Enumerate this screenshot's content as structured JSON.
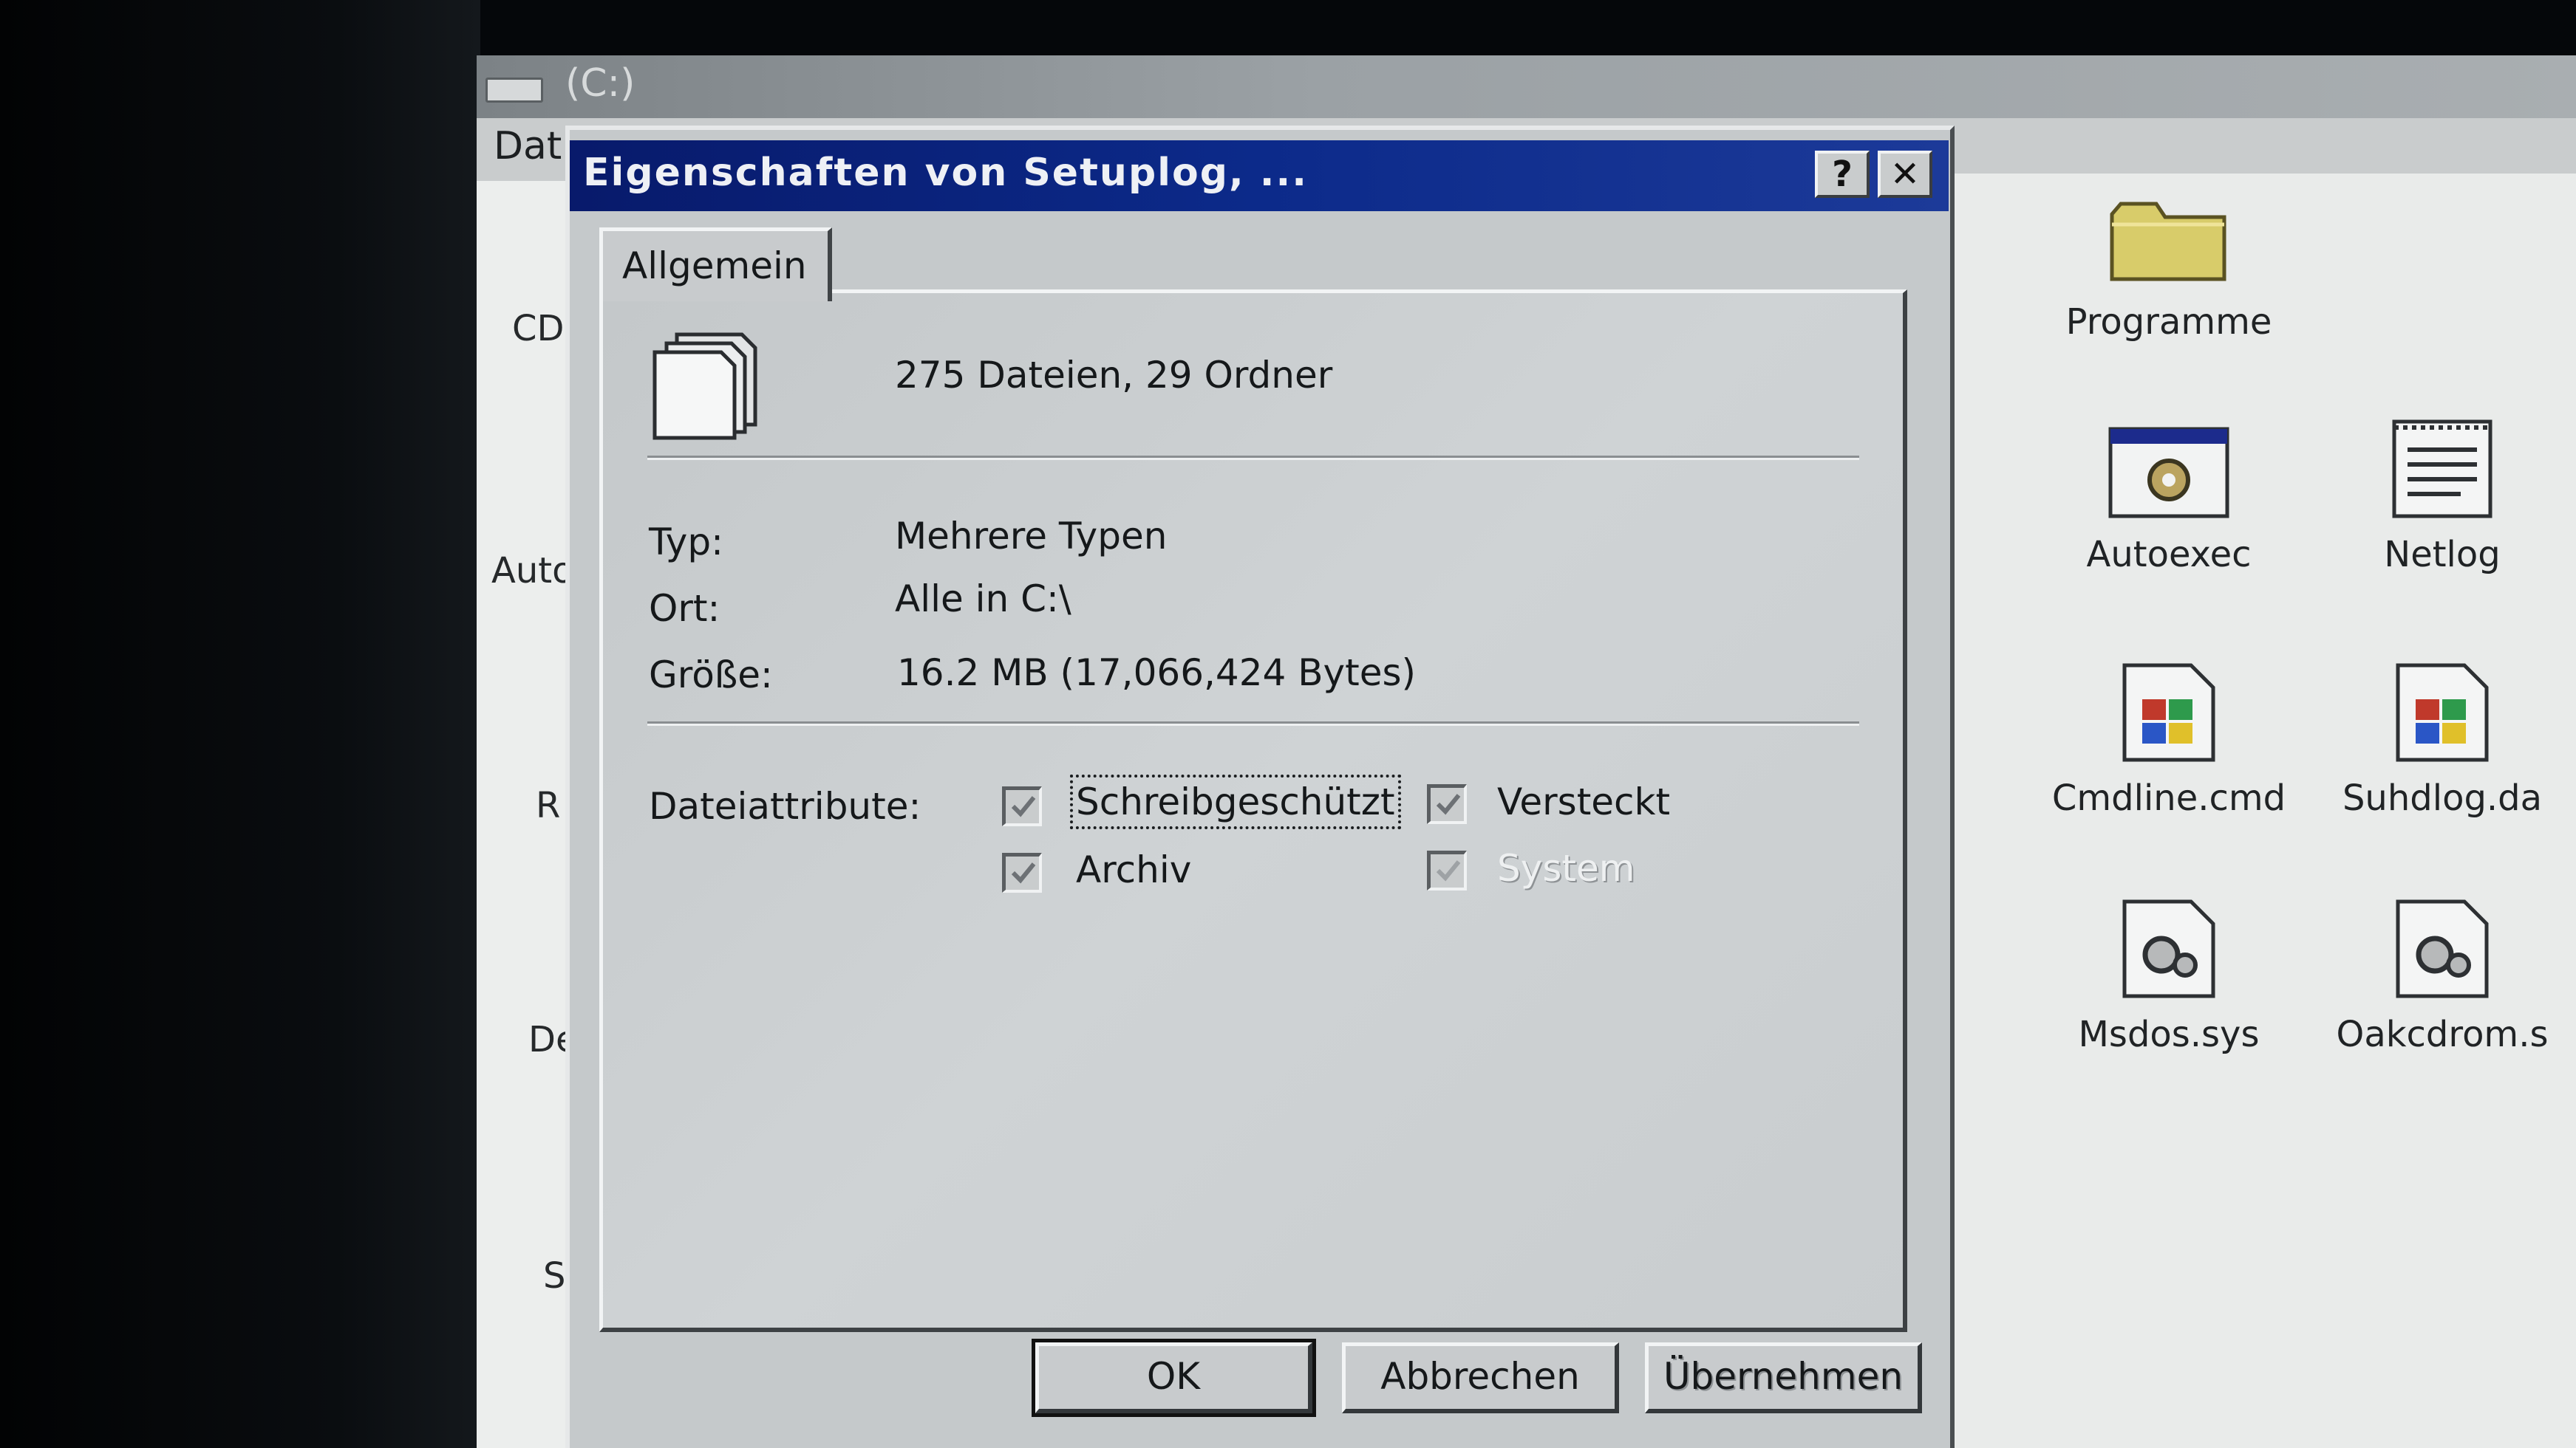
{
  "explorer": {
    "title": "(C:)",
    "menu_fragment": "Dat",
    "left_labels": [
      "CD",
      "Auto",
      "R",
      "De",
      "S"
    ],
    "files": [
      {
        "name": "Programme",
        "icon": "folder-icon"
      },
      {
        "name": "Autoexec",
        "icon": "batch-file-icon"
      },
      {
        "name": "Netlog",
        "icon": "text-file-icon"
      },
      {
        "name": "Cmdline.cmd",
        "icon": "windows-file-icon"
      },
      {
        "name": "Suhdlog.da",
        "icon": "windows-file-icon"
      },
      {
        "name": "Msdos.sys",
        "icon": "system-file-icon"
      },
      {
        "name": "Oakcdrom.s",
        "icon": "system-file-icon"
      }
    ]
  },
  "dialog": {
    "title": "Eigenschaften von Setuplog, ...",
    "help_label": "?",
    "close_label": "✕",
    "tab_label": "Allgemein",
    "summary": "275 Dateien, 29 Ordner",
    "type_label": "Typ:",
    "type_value": "Mehrere Typen",
    "location_label": "Ort:",
    "location_value": "Alle in C:\\",
    "size_label": "Größe:",
    "size_value": "16.2 MB (17,066,424 Bytes)",
    "attributes_label": "Dateiattribute:",
    "attributes": {
      "readonly": {
        "label": "Schreibgeschützt",
        "checked": true
      },
      "hidden": {
        "label": "Versteckt",
        "checked": true
      },
      "archive": {
        "label": "Archiv",
        "checked": true
      },
      "system": {
        "label": "System",
        "checked": true,
        "disabled": true
      }
    },
    "buttons": {
      "ok": "OK",
      "cancel": "Abbrechen",
      "apply": "Übernehmen"
    }
  }
}
